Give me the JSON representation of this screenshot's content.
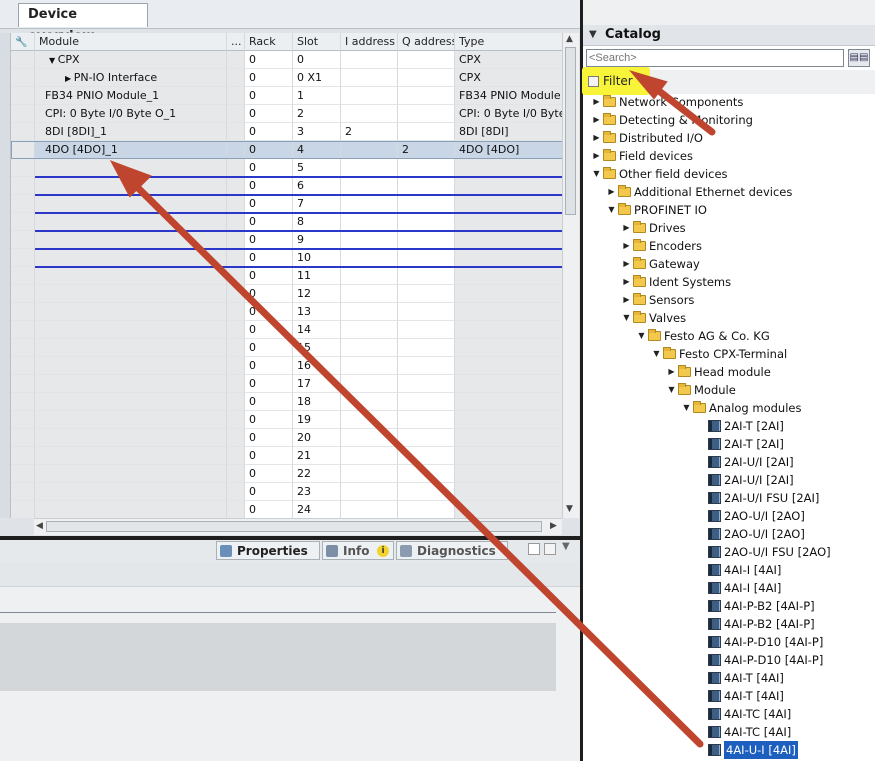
{
  "device_overview": {
    "tab_label": "Device overview",
    "columns": [
      "Module",
      "...",
      "Rack",
      "Slot",
      "I address",
      "Q address",
      "Type"
    ],
    "rows": [
      {
        "indent": 1,
        "expander": "down",
        "module": "CPX",
        "rack": "0",
        "slot": "0",
        "i_address": "",
        "q_address": "",
        "type": "CPX"
      },
      {
        "indent": 2,
        "expander": "right",
        "module": "PN-IO Interface",
        "rack": "0",
        "slot": "0 X1",
        "i_address": "",
        "q_address": "",
        "type": "CPX"
      },
      {
        "indent": 0,
        "expander": "",
        "module": "FB34 PNIO Module_1",
        "rack": "0",
        "slot": "1",
        "i_address": "",
        "q_address": "",
        "type": "FB34 PNIO Module"
      },
      {
        "indent": 0,
        "expander": "",
        "module": "CPI: 0 Byte I/0 Byte O_1",
        "rack": "0",
        "slot": "2",
        "i_address": "",
        "q_address": "",
        "type": "CPI: 0 Byte I/0 Byte..."
      },
      {
        "indent": 0,
        "expander": "",
        "module": "8DI [8DI]_1",
        "rack": "0",
        "slot": "3",
        "i_address": "2",
        "q_address": "",
        "type": "8DI [8DI]"
      },
      {
        "indent": 0,
        "expander": "",
        "module": "4DO [4DO]_1",
        "rack": "0",
        "slot": "4",
        "i_address": "",
        "q_address": "2",
        "type": "4DO [4DO]",
        "selected": true
      },
      {
        "indent": 0,
        "expander": "",
        "module": "",
        "rack": "0",
        "slot": "5",
        "i_address": "",
        "q_address": "",
        "type": ""
      },
      {
        "indent": 0,
        "expander": "",
        "module": "",
        "rack": "0",
        "slot": "6",
        "i_address": "",
        "q_address": "",
        "type": ""
      },
      {
        "indent": 0,
        "expander": "",
        "module": "",
        "rack": "0",
        "slot": "7",
        "i_address": "",
        "q_address": "",
        "type": ""
      },
      {
        "indent": 0,
        "expander": "",
        "module": "",
        "rack": "0",
        "slot": "8",
        "i_address": "",
        "q_address": "",
        "type": ""
      },
      {
        "indent": 0,
        "expander": "",
        "module": "",
        "rack": "0",
        "slot": "9",
        "i_address": "",
        "q_address": "",
        "type": ""
      },
      {
        "indent": 0,
        "expander": "",
        "module": "",
        "rack": "0",
        "slot": "10",
        "i_address": "",
        "q_address": "",
        "type": ""
      },
      {
        "indent": 0,
        "expander": "",
        "module": "",
        "rack": "0",
        "slot": "11",
        "i_address": "",
        "q_address": "",
        "type": ""
      },
      {
        "indent": 0,
        "expander": "",
        "module": "",
        "rack": "0",
        "slot": "12",
        "i_address": "",
        "q_address": "",
        "type": ""
      },
      {
        "indent": 0,
        "expander": "",
        "module": "",
        "rack": "0",
        "slot": "13",
        "i_address": "",
        "q_address": "",
        "type": ""
      },
      {
        "indent": 0,
        "expander": "",
        "module": "",
        "rack": "0",
        "slot": "14",
        "i_address": "",
        "q_address": "",
        "type": ""
      },
      {
        "indent": 0,
        "expander": "",
        "module": "",
        "rack": "0",
        "slot": "15",
        "i_address": "",
        "q_address": "",
        "type": ""
      },
      {
        "indent": 0,
        "expander": "",
        "module": "",
        "rack": "0",
        "slot": "16",
        "i_address": "",
        "q_address": "",
        "type": ""
      },
      {
        "indent": 0,
        "expander": "",
        "module": "",
        "rack": "0",
        "slot": "17",
        "i_address": "",
        "q_address": "",
        "type": ""
      },
      {
        "indent": 0,
        "expander": "",
        "module": "",
        "rack": "0",
        "slot": "18",
        "i_address": "",
        "q_address": "",
        "type": ""
      },
      {
        "indent": 0,
        "expander": "",
        "module": "",
        "rack": "0",
        "slot": "19",
        "i_address": "",
        "q_address": "",
        "type": ""
      },
      {
        "indent": 0,
        "expander": "",
        "module": "",
        "rack": "0",
        "slot": "20",
        "i_address": "",
        "q_address": "",
        "type": ""
      },
      {
        "indent": 0,
        "expander": "",
        "module": "",
        "rack": "0",
        "slot": "21",
        "i_address": "",
        "q_address": "",
        "type": ""
      },
      {
        "indent": 0,
        "expander": "",
        "module": "",
        "rack": "0",
        "slot": "22",
        "i_address": "",
        "q_address": "",
        "type": ""
      },
      {
        "indent": 0,
        "expander": "",
        "module": "",
        "rack": "0",
        "slot": "23",
        "i_address": "",
        "q_address": "",
        "type": ""
      },
      {
        "indent": 0,
        "expander": "",
        "module": "",
        "rack": "0",
        "slot": "24",
        "i_address": "",
        "q_address": "",
        "type": ""
      }
    ]
  },
  "inspector": {
    "properties_label": "Properties",
    "info_label": "Info",
    "diagnostics_label": "Diagnostics"
  },
  "catalog": {
    "title": "Catalog",
    "search_placeholder": "<Search>",
    "search_button_glyph": "▤▤",
    "filter_label": "Filter",
    "tree": [
      {
        "level": 0,
        "exp": "right",
        "icon": "folder",
        "label": "Network Components"
      },
      {
        "level": 0,
        "exp": "right",
        "icon": "folder",
        "label": "Detecting & Monitoring"
      },
      {
        "level": 0,
        "exp": "right",
        "icon": "folder",
        "label": "Distributed I/O"
      },
      {
        "level": 0,
        "exp": "right",
        "icon": "folder",
        "label": "Field devices"
      },
      {
        "level": 0,
        "exp": "down",
        "icon": "folder",
        "label": "Other field devices"
      },
      {
        "level": 1,
        "exp": "right",
        "icon": "folder",
        "label": "Additional Ethernet devices"
      },
      {
        "level": 1,
        "exp": "down",
        "icon": "folder",
        "label": "PROFINET IO"
      },
      {
        "level": 2,
        "exp": "right",
        "icon": "folder",
        "label": "Drives"
      },
      {
        "level": 2,
        "exp": "right",
        "icon": "folder",
        "label": "Encoders"
      },
      {
        "level": 2,
        "exp": "right",
        "icon": "folder",
        "label": "Gateway"
      },
      {
        "level": 2,
        "exp": "right",
        "icon": "folder",
        "label": "Ident Systems"
      },
      {
        "level": 2,
        "exp": "right",
        "icon": "folder",
        "label": "Sensors"
      },
      {
        "level": 2,
        "exp": "down",
        "icon": "folder",
        "label": "Valves"
      },
      {
        "level": 3,
        "exp": "down",
        "icon": "folder",
        "label": "Festo AG & Co. KG"
      },
      {
        "level": 4,
        "exp": "down",
        "icon": "folder",
        "label": "Festo CPX-Terminal"
      },
      {
        "level": 5,
        "exp": "right",
        "icon": "folder",
        "label": "Head module"
      },
      {
        "level": 5,
        "exp": "down",
        "icon": "folder",
        "label": "Module"
      },
      {
        "level": 6,
        "exp": "down",
        "icon": "folder",
        "label": "Analog modules"
      },
      {
        "level": 7,
        "exp": "",
        "icon": "module",
        "label": "2AI-T [2AI]"
      },
      {
        "level": 7,
        "exp": "",
        "icon": "module",
        "label": "2AI-T [2AI]"
      },
      {
        "level": 7,
        "exp": "",
        "icon": "module",
        "label": "2AI-U/I [2AI]"
      },
      {
        "level": 7,
        "exp": "",
        "icon": "module",
        "label": "2AI-U/I [2AI]"
      },
      {
        "level": 7,
        "exp": "",
        "icon": "module",
        "label": "2AI-U/I FSU [2AI]"
      },
      {
        "level": 7,
        "exp": "",
        "icon": "module",
        "label": "2AO-U/I [2AO]"
      },
      {
        "level": 7,
        "exp": "",
        "icon": "module",
        "label": "2AO-U/I [2AO]"
      },
      {
        "level": 7,
        "exp": "",
        "icon": "module",
        "label": "2AO-U/I FSU [2AO]"
      },
      {
        "level": 7,
        "exp": "",
        "icon": "module",
        "label": "4AI-I [4AI]"
      },
      {
        "level": 7,
        "exp": "",
        "icon": "module",
        "label": "4AI-I [4AI]"
      },
      {
        "level": 7,
        "exp": "",
        "icon": "module",
        "label": "4AI-P-B2 [4AI-P]"
      },
      {
        "level": 7,
        "exp": "",
        "icon": "module",
        "label": "4AI-P-B2 [4AI-P]"
      },
      {
        "level": 7,
        "exp": "",
        "icon": "module",
        "label": "4AI-P-D10 [4AI-P]"
      },
      {
        "level": 7,
        "exp": "",
        "icon": "module",
        "label": "4AI-P-D10 [4AI-P]"
      },
      {
        "level": 7,
        "exp": "",
        "icon": "module",
        "label": "4AI-T [4AI]"
      },
      {
        "level": 7,
        "exp": "",
        "icon": "module",
        "label": "4AI-T [4AI]"
      },
      {
        "level": 7,
        "exp": "",
        "icon": "module",
        "label": "4AI-TC [4AI]"
      },
      {
        "level": 7,
        "exp": "",
        "icon": "module",
        "label": "4AI-TC [4AI]"
      },
      {
        "level": 7,
        "exp": "",
        "icon": "module",
        "label": "4AI-U-I [4AI]",
        "selected": true
      }
    ]
  },
  "colors": {
    "annotation_arrow": "#c0452e",
    "filter_highlight": "#f7f43a",
    "insert_line": "#2a37c8",
    "selection": "#1c5fbf"
  }
}
